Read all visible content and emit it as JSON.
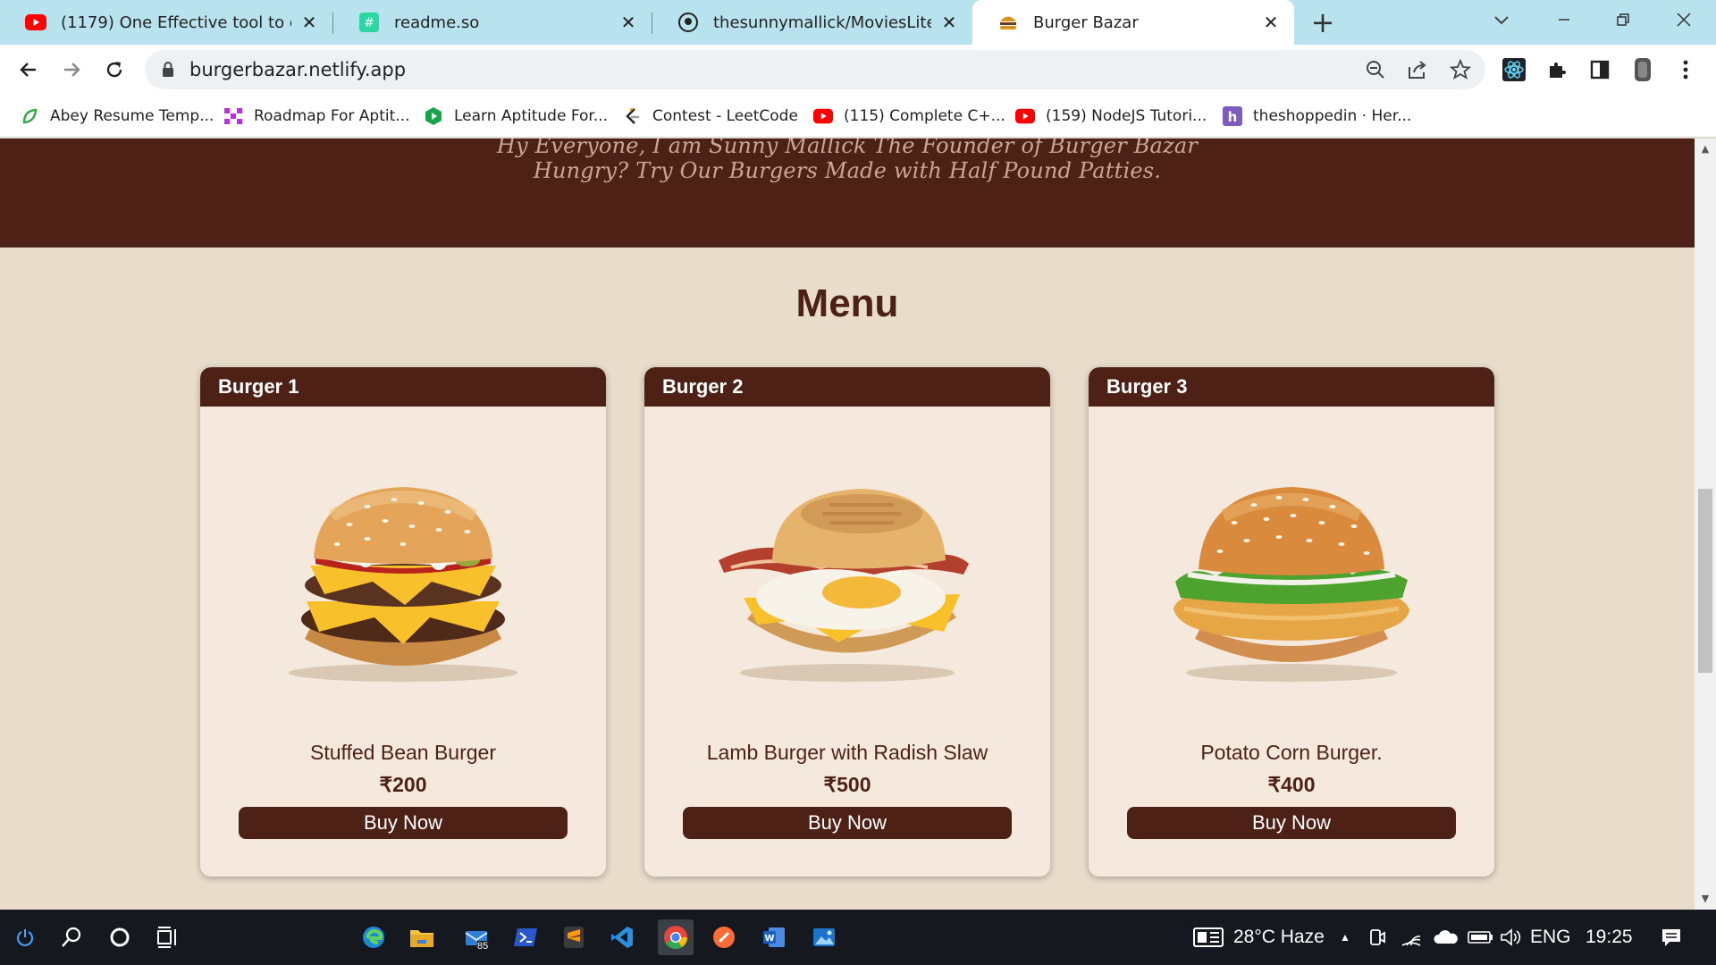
{
  "browser": {
    "tabs": [
      {
        "title": "(1179) One Effective tool to creat",
        "icon": "youtube-icon",
        "active": false
      },
      {
        "title": "readme.so",
        "icon": "readme-icon",
        "active": false
      },
      {
        "title": "thesunnymallick/MoviesLite",
        "icon": "github-icon",
        "active": false
      },
      {
        "title": "Burger Bazar",
        "icon": "burger-icon",
        "active": true
      }
    ],
    "url": "burgerbazar.netlify.app",
    "bookmarks": [
      {
        "label": "Abey Resume Temp...",
        "icon": "leaf-icon"
      },
      {
        "label": "Roadmap For Aptit...",
        "icon": "roadmap-icon"
      },
      {
        "label": "Learn Aptitude For...",
        "icon": "hex-play-icon"
      },
      {
        "label": "Contest - LeetCode",
        "icon": "leetcode-icon"
      },
      {
        "label": "(115) Complete C+...",
        "icon": "youtube-icon"
      },
      {
        "label": "(159) NodeJS Tutori...",
        "icon": "youtube-icon"
      },
      {
        "label": "theshoppedin · Her...",
        "icon": "heroku-icon"
      }
    ]
  },
  "page": {
    "hero_line1": "Hy Everyone, I am Sunny Mallick The Founder of Burger Bazar",
    "hero_line2": "Hungry? Try Our Burgers Made with Half Pound Patties.",
    "menu_title": "Menu",
    "cards": [
      {
        "header": "Burger 1",
        "name": "Stuffed Bean Burger",
        "price": "₹200",
        "button": "Buy Now"
      },
      {
        "header": "Burger 2",
        "name": "Lamb Burger with Radish Slaw",
        "price": "₹500",
        "button": "Buy Now"
      },
      {
        "header": "Burger 3",
        "name": "Potato Corn Burger.",
        "price": "₹400",
        "button": "Buy Now"
      }
    ]
  },
  "taskbar": {
    "weather": "28°C  Haze",
    "language": "ENG",
    "time": "19:25",
    "mail_badge": "85"
  },
  "colors": {
    "brand_brown": "#4e2116",
    "page_bg": "#e9dccb",
    "card_bg": "#f5e9dd",
    "tabstrip_bg": "#b8e3ee"
  }
}
